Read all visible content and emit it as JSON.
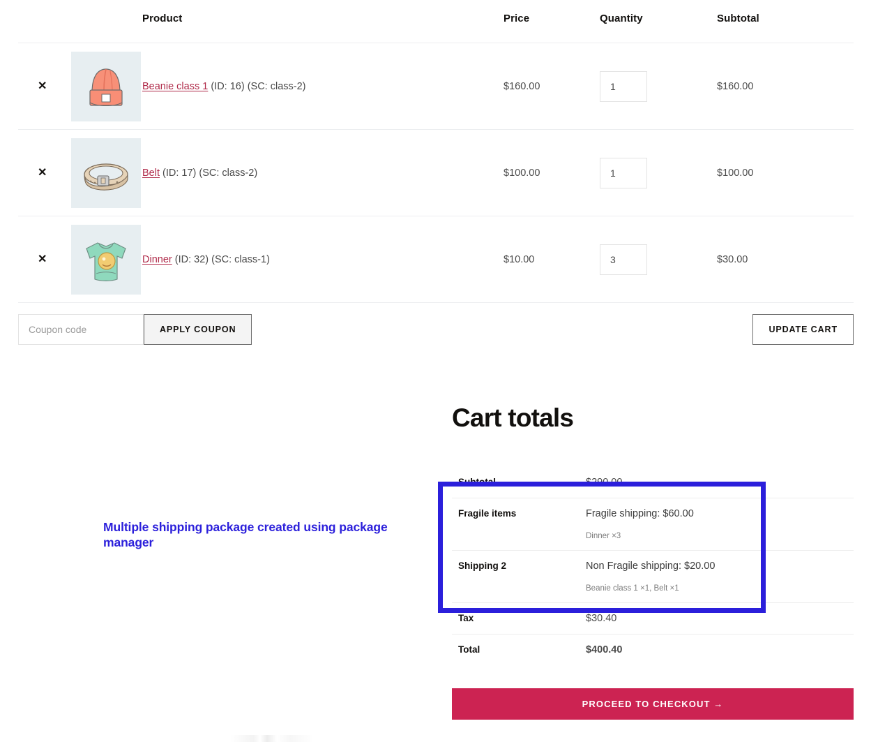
{
  "cart": {
    "columns": {
      "remove": "",
      "thumb": "",
      "product": "Product",
      "price": "Price",
      "quantity": "Quantity",
      "subtotal": "Subtotal"
    },
    "remove_glyph": "✕",
    "items": [
      {
        "name": "Beanie class 1",
        "meta": " (ID: 16) (SC: class-2)",
        "price": "$160.00",
        "qty": "1",
        "subtotal": "$160.00",
        "thumb_icon": "beanie-thumbnail"
      },
      {
        "name": "Belt",
        "meta": " (ID: 17) (SC: class-2)",
        "price": "$100.00",
        "qty": "1",
        "subtotal": "$100.00",
        "thumb_icon": "belt-thumbnail"
      },
      {
        "name": "Dinner",
        "meta": " (ID: 32) (SC: class-1)",
        "price": "$10.00",
        "qty": "3",
        "subtotal": "$30.00",
        "thumb_icon": "tshirt-thumbnail"
      }
    ],
    "actions": {
      "coupon_placeholder": "Coupon code",
      "coupon_value": "",
      "apply_coupon_label": "APPLY COUPON",
      "update_cart_label": "UPDATE CART"
    }
  },
  "totals": {
    "title": "Cart totals",
    "subtotal_label": "Subtotal",
    "subtotal_value": "$290.00",
    "shipping_packages": [
      {
        "label": "Fragile items",
        "method": "Fragile shipping: $60.00",
        "items": "Dinner ×3"
      },
      {
        "label": "Shipping 2",
        "method": "Non Fragile shipping: $20.00",
        "items": "Beanie class 1 ×1, Belt ×1"
      }
    ],
    "tax_label": "Tax",
    "tax_value": "$30.40",
    "total_label": "Total",
    "total_value": "$400.40",
    "checkout_label": "PROCEED TO CHECKOUT →"
  },
  "annotation": {
    "text": "Multiple shipping package created using package manager",
    "color": "#2b1fdb"
  },
  "colors": {
    "accent_pink": "#cc2352",
    "link": "#b02b4a",
    "highlight_blue": "#2b1fdb",
    "thumb_bg": "#e7eef1"
  }
}
